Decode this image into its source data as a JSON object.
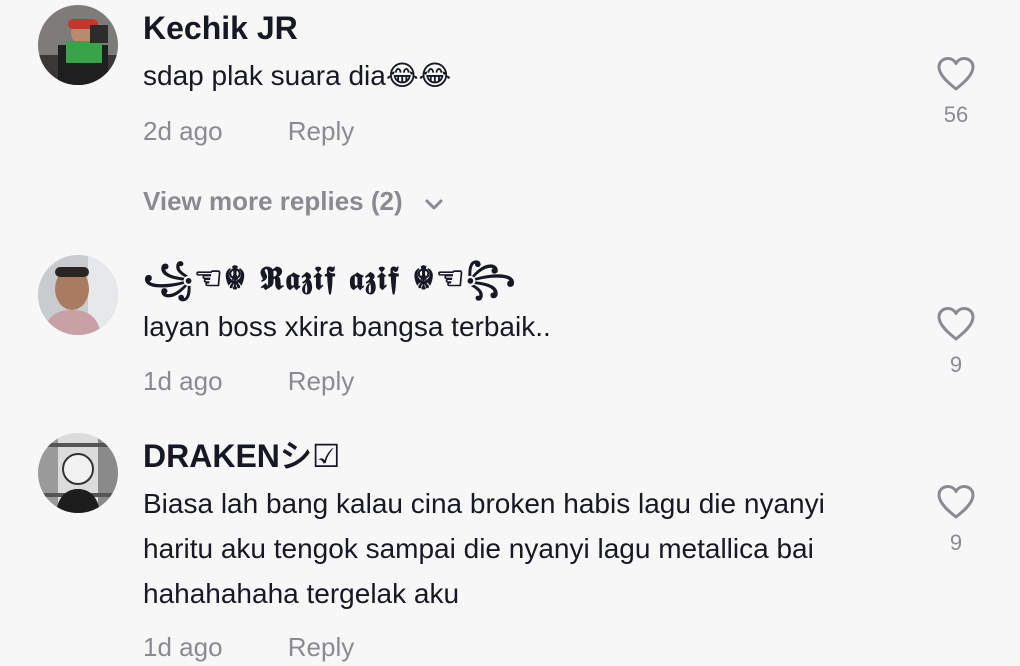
{
  "comments": [
    {
      "username": "Kechik JR",
      "text": "sdap plak suara dia",
      "emoji": "😂😂",
      "time": "2d ago",
      "reply_label": "Reply",
      "likes": "56"
    },
    {
      "username": "꧁☜☬ 𝕽𝖆𝖟𝖎𝖋 𝖆𝖟𝖎𝖋 ☬☜꧂",
      "text": "layan boss xkira bangsa terbaik..",
      "time": "1d ago",
      "reply_label": "Reply",
      "likes": "9"
    },
    {
      "username": "DRAKENシ☑",
      "text": "Biasa lah bang kalau cina broken habis lagu die nyanyi haritu aku tengok sampai die nyanyi lagu metallica bai hahahahaha tergelak aku",
      "time": "1d ago",
      "reply_label": "Reply",
      "likes": "9"
    }
  ],
  "view_more_replies": "View more replies (2)",
  "colors": {
    "background": "#f7f7f7",
    "primary_text": "#161823",
    "secondary_text": "#8a8b91"
  },
  "icons": {
    "like": "heart-outline-icon",
    "expand": "chevron-down-icon"
  }
}
